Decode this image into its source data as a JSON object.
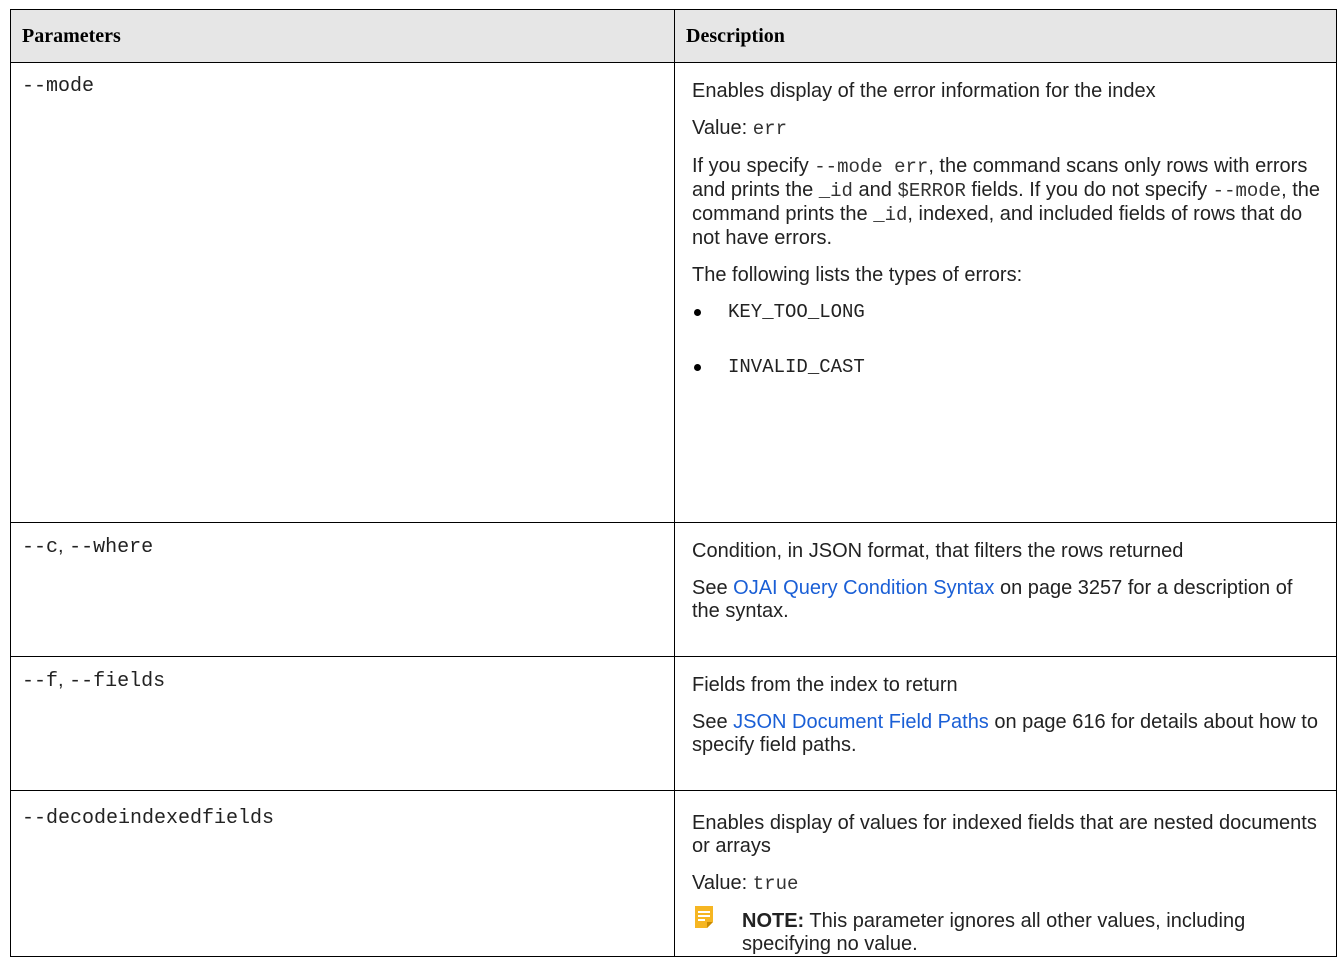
{
  "table": {
    "header": {
      "parameters": "Parameters",
      "description": "Description"
    },
    "mode": {
      "param": "--mode",
      "desc1": "Enables display of the error information for the index",
      "value_label": "Value: ",
      "value": "err",
      "p3_a": "If you specify ",
      "p3_code1": "--mode err",
      "p3_b": ", the command scans only rows with errors and prints the ",
      "p3_code2": "_id",
      "p3_c": " and ",
      "p3_code3": "$ERROR",
      "p3_d": " fields. If you do not specify ",
      "p3_code4": "--mode",
      "p3_e": ", the command prints the ",
      "p3_code5": "_id",
      "p3_f": ", indexed, and included fields of rows that do not have errors.",
      "list_intro": "The following lists the types of errors:",
      "errors": [
        "KEY_TOO_LONG",
        "INVALID_CAST"
      ]
    },
    "where": {
      "param_a": "--c",
      "param_sep": ", ",
      "param_b": "--where",
      "desc1": "Condition, in JSON format, that filters the rows returned",
      "see": "See ",
      "link": "OJAI Query Condition Syntax",
      "after": " on page 3257 for a description of the syntax."
    },
    "fields": {
      "param_a": "--f",
      "param_sep": ", ",
      "param_b": "--fields",
      "desc1": "Fields from the index to return",
      "see": "See ",
      "link": "JSON Document Field Paths",
      "after": " on page 616 for details about how to specify field paths."
    },
    "decode": {
      "param": "--decodeindexedfields",
      "desc1": "Enables display of values for indexed fields that are nested documents or arrays",
      "value_label": "Value: ",
      "value": "true",
      "note_label": "NOTE:",
      "note_text": " This parameter ignores all other values, including specifying no value.",
      "note_icon": "note-icon"
    }
  }
}
